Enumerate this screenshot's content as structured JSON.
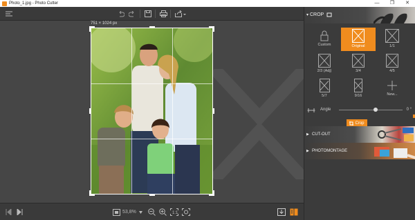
{
  "window": {
    "title": "Photo_1.jpg - Photo Cutter",
    "controls": [
      "—",
      "❐",
      "✕"
    ]
  },
  "toolbar": {
    "icons": [
      "menu-icon",
      "undo-icon",
      "redo-icon",
      "save-icon",
      "print-icon",
      "share-icon"
    ]
  },
  "canvas": {
    "image_size_label": "751 × 1024 px"
  },
  "bottom_bar": {
    "zoom_value": "53,8%",
    "icons": [
      "prev-icon",
      "next-icon",
      "fit-icon",
      "zoom-out-icon",
      "zoom-in-icon",
      "actual-size-icon",
      "zoom-fit-icon",
      "export-icon",
      "compare-icon"
    ]
  },
  "panel": {
    "crop_title": "CROP",
    "presets": [
      {
        "label": "Custom",
        "active": false
      },
      {
        "label": "Original",
        "active": true
      },
      {
        "label": "1/1",
        "active": false
      },
      {
        "label": "2/3 (Adj)",
        "active": false
      },
      {
        "label": "3/4",
        "active": false
      },
      {
        "label": "4/5",
        "active": false
      },
      {
        "label": "5/7",
        "active": false
      },
      {
        "label": "9/16",
        "active": false
      },
      {
        "label": "New...",
        "active": false
      }
    ],
    "angle_label": "Angle",
    "angle_value": "0 °",
    "angle_slider_fraction": 0.58,
    "crop_button": "Crop",
    "sections": [
      {
        "label": "CUT-OUT"
      },
      {
        "label": "PHOTOMONTAGE"
      }
    ],
    "accent_color": "#f08c1e"
  }
}
